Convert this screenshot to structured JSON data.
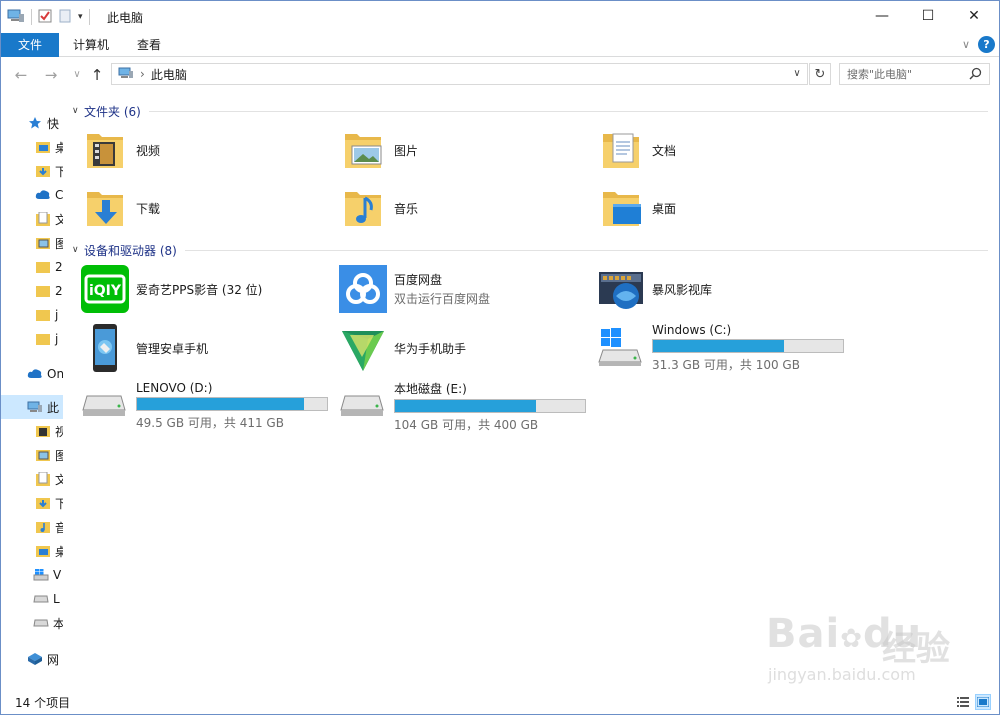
{
  "window": {
    "title": "此电脑",
    "minimize_glyph": "—",
    "maximize_glyph": "☐",
    "close_glyph": "✕"
  },
  "ribbon": {
    "tabs": [
      "文件",
      "计算机",
      "查看"
    ],
    "expand_glyph": "∨",
    "help_glyph": "?"
  },
  "nav": {
    "back_glyph": "←",
    "forward_glyph": "→",
    "recent_glyph": "∨",
    "up_glyph": "↑",
    "breadcrumb": "此电脑",
    "separator": "›",
    "dropdown_glyph": "∨",
    "refresh_glyph": "↻",
    "search_placeholder": "搜索\"此电脑\""
  },
  "sidebar": {
    "items": [
      {
        "label": "快",
        "icon": "star-icon"
      },
      {
        "label": "桌",
        "icon": "desktop-folder-icon"
      },
      {
        "label": "下",
        "icon": "downloads-folder-icon"
      },
      {
        "label": "C",
        "icon": "cloud-icon"
      },
      {
        "label": "文",
        "icon": "documents-folder-icon"
      },
      {
        "label": "图",
        "icon": "pictures-folder-icon"
      },
      {
        "label": "2",
        "icon": "folder-icon"
      },
      {
        "label": "2",
        "icon": "folder-icon"
      },
      {
        "label": "j",
        "icon": "folder-icon"
      },
      {
        "label": "j",
        "icon": "folder-icon"
      },
      {
        "label": "On",
        "icon": "onedrive-icon"
      },
      {
        "label": "此",
        "icon": "this-pc-icon"
      },
      {
        "label": "视",
        "icon": "videos-folder-icon"
      },
      {
        "label": "图",
        "icon": "pictures-folder-icon"
      },
      {
        "label": "文",
        "icon": "documents-folder-icon"
      },
      {
        "label": "下",
        "icon": "downloads-folder-icon"
      },
      {
        "label": "音",
        "icon": "music-folder-icon"
      },
      {
        "label": "桌",
        "icon": "desktop-folder-icon"
      },
      {
        "label": "V",
        "icon": "windows-drive-icon"
      },
      {
        "label": "L",
        "icon": "drive-icon"
      },
      {
        "label": "本",
        "icon": "drive-icon"
      },
      {
        "label": "网",
        "icon": "network-icon"
      }
    ]
  },
  "groups": {
    "folders": {
      "title": "文件夹 (6)",
      "items": [
        {
          "name": "视频",
          "icon": "videos-folder-icon"
        },
        {
          "name": "图片",
          "icon": "pictures-folder-icon"
        },
        {
          "name": "文档",
          "icon": "documents-folder-icon"
        },
        {
          "name": "下载",
          "icon": "downloads-folder-icon"
        },
        {
          "name": "音乐",
          "icon": "music-folder-icon"
        },
        {
          "name": "桌面",
          "icon": "desktop-folder-icon"
        }
      ]
    },
    "devices": {
      "title": "设备和驱动器 (8)",
      "apps": [
        {
          "name": "爱奇艺PPS影音 (32 位)",
          "subtitle": "",
          "icon": "iqiyi-icon",
          "color": "#00be06"
        },
        {
          "name": "百度网盘",
          "subtitle": "双击运行百度网盘",
          "icon": "baidu-netdisk-icon",
          "color": "#3a8ee6"
        },
        {
          "name": "暴风影视库",
          "subtitle": "",
          "icon": "baofeng-library-icon",
          "color": "#1f5fa8"
        },
        {
          "name": "管理安卓手机",
          "subtitle": "",
          "icon": "android-phone-icon",
          "color": "#2b2b2b"
        },
        {
          "name": "华为手机助手",
          "subtitle": "",
          "icon": "huawei-hisuite-icon",
          "color": "#2aa864"
        }
      ],
      "drives": [
        {
          "name": "Windows (C:)",
          "free": "31.3 GB 可用，共 100 GB",
          "used_fraction": 0.687,
          "icon": "windows-drive-icon"
        },
        {
          "name": "LENOVO (D:)",
          "free": "49.5 GB 可用，共 411 GB",
          "used_fraction": 0.88,
          "icon": "drive-icon"
        },
        {
          "name": "本地磁盘 (E:)",
          "free": "104 GB 可用，共 400 GB",
          "used_fraction": 0.74,
          "icon": "drive-icon"
        }
      ]
    }
  },
  "status": {
    "count": "14 个项目"
  },
  "watermark": {
    "main": "Bai",
    "du": "du",
    "cn": "经验",
    "url": "jingyan.baidu.com"
  },
  "colors": {
    "accent": "#1979ca",
    "drive_fill": "#26a0da",
    "selected": "#cce8ff",
    "group_title": "#1e3287"
  }
}
